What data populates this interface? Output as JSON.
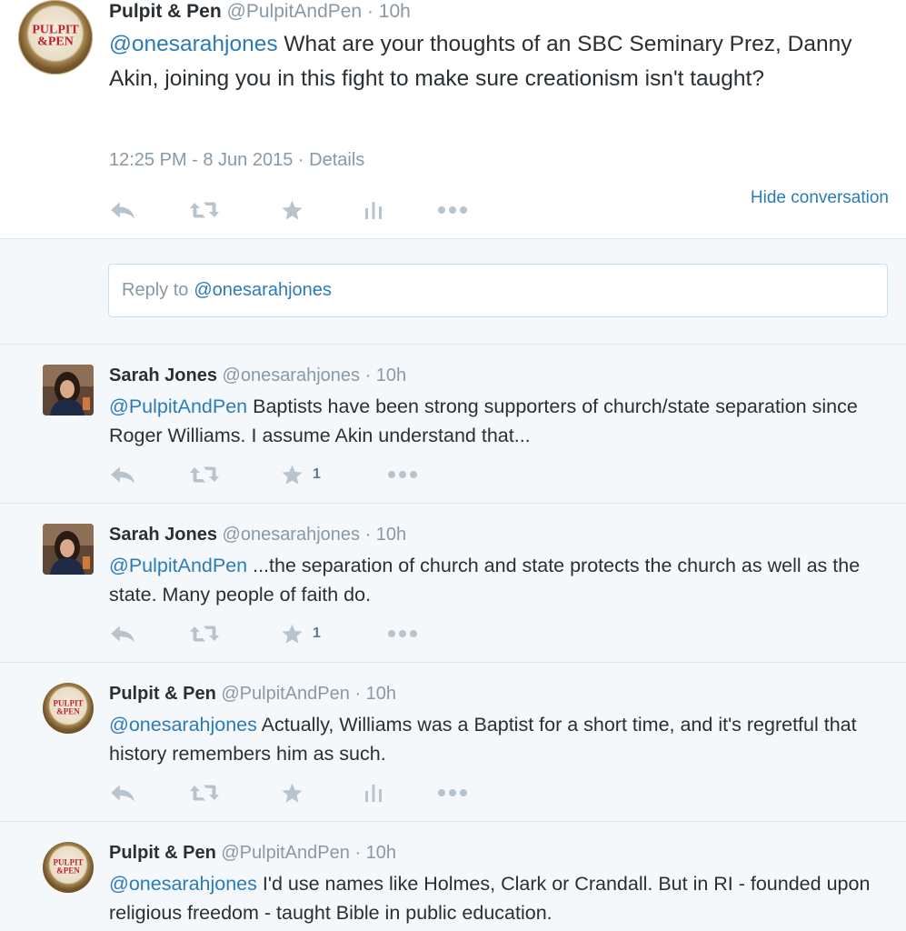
{
  "main_tweet": {
    "name": "Pulpit & Pen",
    "handle": "@PulpitAndPen",
    "time": "· 10h",
    "mention": "@onesarahjones",
    "text": " What are your thoughts of an SBC Seminary Prez, Danny Akin, joining you in this fight to make sure creationism isn't taught?",
    "timestamp": "12:25 PM - 8 Jun 2015",
    "details_link": "· Details",
    "hide_conversation": "Hide conversation",
    "avatar_logo": {
      "line1": "PULPIT",
      "line2": "&PEN"
    }
  },
  "reply_box": {
    "prefix": "Reply to",
    "mention": "@onesarahjones"
  },
  "replies": [
    {
      "name": "Sarah Jones",
      "handle": "@onesarahjones",
      "time": "· 10h",
      "mention": "@PulpitAndPen",
      "text": " Baptists have been strong supporters of church/state separation since Roger Williams. I assume Akin understand that...",
      "favorites": "1"
    },
    {
      "name": "Sarah Jones",
      "handle": "@onesarahjones",
      "time": "· 10h",
      "mention": "@PulpitAndPen",
      "text": " ...the separation of church and state protects the church as well as the state. Many people of faith do.",
      "favorites": "1"
    },
    {
      "name": "Pulpit & Pen",
      "handle": "@PulpitAndPen",
      "time": "· 10h",
      "mention": "@onesarahjones",
      "text": " Actually, Williams was a Baptist for a short time, and it's regretful that history remembers him as such."
    },
    {
      "name": "Pulpit & Pen",
      "handle": "@PulpitAndPen",
      "time": "· 10h",
      "mention": "@onesarahjones",
      "text": " I'd use names like Holmes, Clark or Crandall. But in RI - founded upon religious freedom - taught Bible in public education."
    }
  ],
  "icons": {
    "reply": "reply-arrow-icon",
    "retweet": "retweet-icon",
    "favorite": "star-icon",
    "analytics": "bar-chart-icon",
    "more": "ellipsis-icon"
  },
  "colors": {
    "link": "#2b7bb9",
    "muted": "#8899a6",
    "icon": "#b8c4cd",
    "background": "#f5f8fa",
    "logo_red": "#c0202a"
  }
}
